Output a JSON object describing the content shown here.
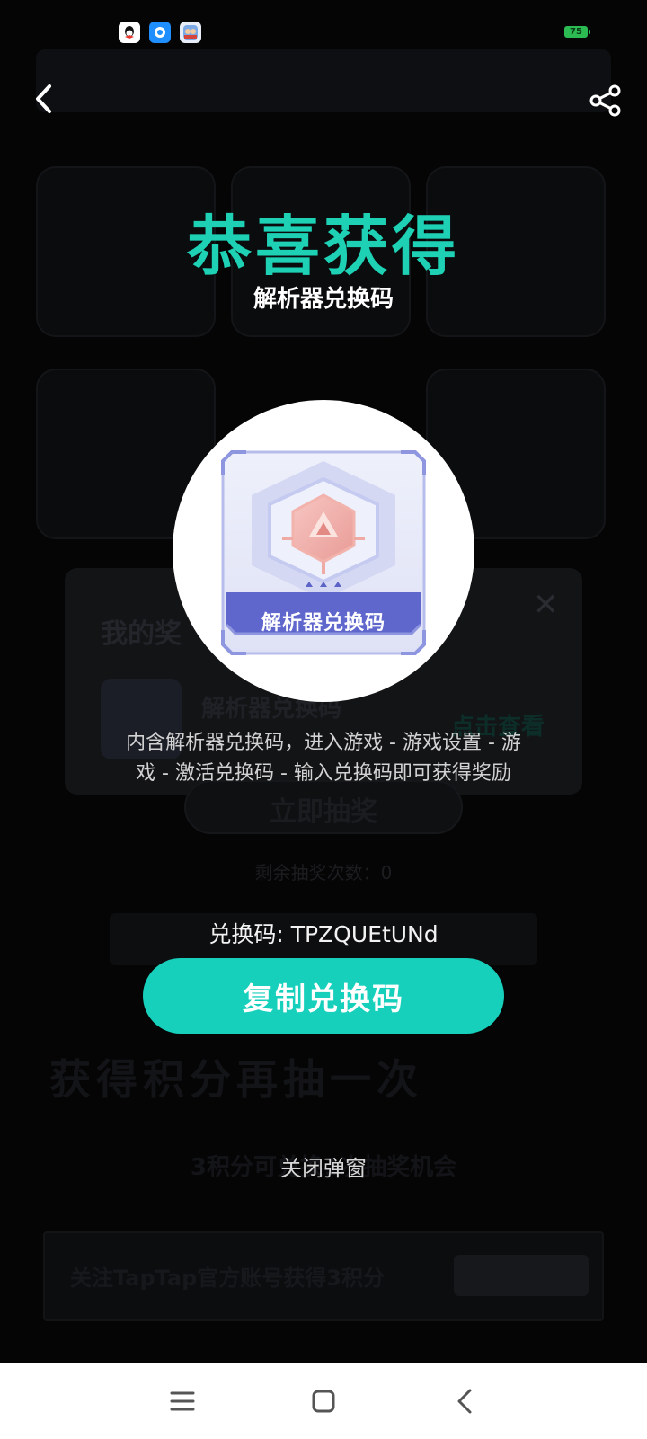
{
  "status_bar": {
    "app_icons": [
      "qq-icon",
      "messenger-icon",
      "game-icon"
    ],
    "battery_level": "75",
    "battery_color": "#2bbb52"
  },
  "top_bar": {
    "back_icon": "chevron-left-icon",
    "share_icon": "share-icon"
  },
  "modal": {
    "title": "恭喜获得",
    "prize_name": "解析器兑换码",
    "card_label": "解析器兑换码",
    "description": "内含解析器兑换码，进入游戏 - 游戏设置 - 游戏 - 激活兑换码 - 输入兑换码即可获得奖励",
    "code_line": "兑换码: TPZQUEtUNd",
    "copy_button": "复制兑换码",
    "close_link": "关闭弹窗",
    "accent_color": "#1ed1b4",
    "button_color": "#17d0bc"
  },
  "background_page": {
    "my_prizes_title": "我的奖",
    "prize_name": "解析器兑换码",
    "view_link": "点击查看",
    "draw_button": "立即抽奖",
    "remaining": "剩余抽奖次数：0",
    "points_title": "获得积分再抽一次",
    "points_sub": "3积分可兑换1次抽奖机会",
    "task_text": "关注TapTap官方账号获得3积分"
  },
  "nav_bar": {
    "menu_icon": "menu-icon",
    "home_icon": "home-square-icon",
    "back_icon": "back-triangle-icon"
  }
}
